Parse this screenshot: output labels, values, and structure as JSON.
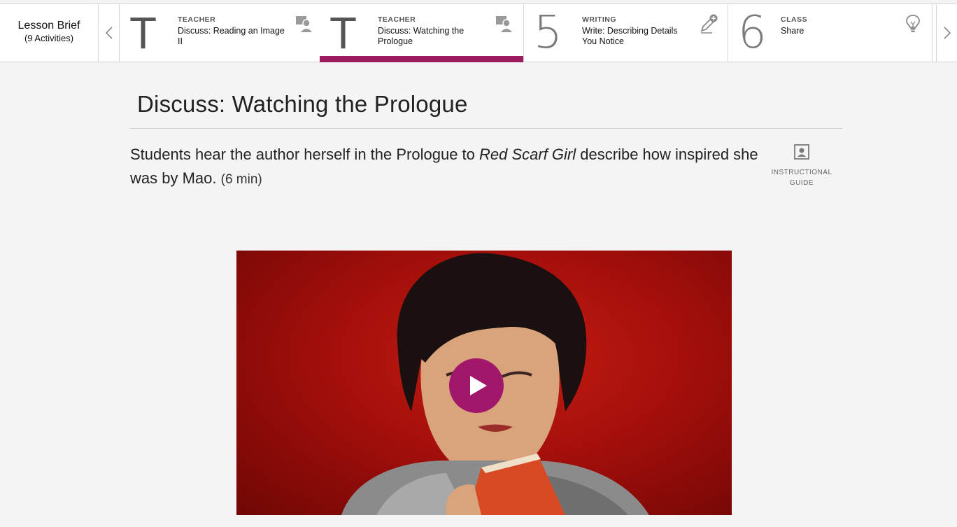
{
  "lesson_brief": {
    "title": "Lesson Brief",
    "subtitle": "(9 Activities)"
  },
  "activities": [
    {
      "marker": "T",
      "kind": "TEACHER",
      "title": "Discuss: Reading an Image II",
      "icon": "teacher-icon",
      "active": false
    },
    {
      "marker": "T",
      "kind": "TEACHER",
      "title": "Discuss: Watching the Prologue",
      "icon": "teacher-icon",
      "active": true
    },
    {
      "marker": "5",
      "kind": "WRITING",
      "title": "Write: Describing Details You Notice",
      "icon": "pencil-plus-icon",
      "active": false
    },
    {
      "marker": "6",
      "kind": "CLASS",
      "title": "Share",
      "icon": "lightbulb-icon",
      "active": false
    }
  ],
  "main": {
    "title": "Discuss: Watching the Prologue",
    "desc_before": "Students hear the author herself in the Prologue to ",
    "desc_book": "Red Scarf Girl",
    "desc_after": " describe how inspired she was by Mao.",
    "duration": "(6 min)"
  },
  "guide": {
    "line1": "INSTRUCTIONAL",
    "line2": "GUIDE",
    "icon": "instructional-guide-icon"
  },
  "video": {
    "icon": "play-icon"
  },
  "colors": {
    "accent": "#9c1b5e",
    "play_button": "#a0176b",
    "video_bg": "#b5140e"
  }
}
